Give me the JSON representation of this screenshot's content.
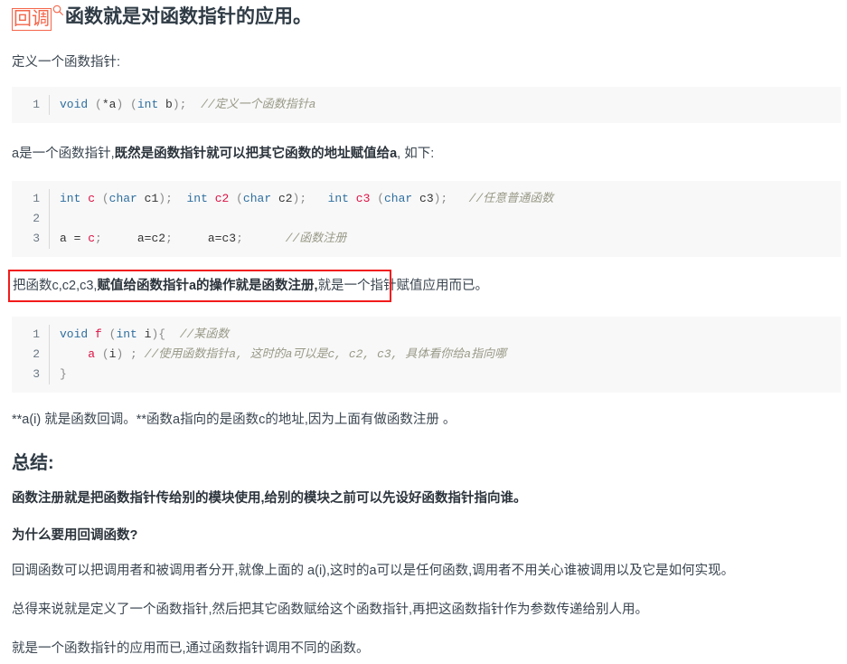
{
  "document": {
    "title_keyword": "回调",
    "title_icon": "search-icon",
    "title_rest": "函数就是对函数指针的应用。",
    "paragraphs": {
      "p_define": "定义一个函数指针:",
      "p_a_is_pointer_1": "a是一个函数指针,",
      "p_a_is_pointer_bold": "既然是函数指针就可以把其它函数的地址赋值给a",
      "p_a_is_pointer_2": ", 如下:",
      "p_register_1": "把函数c,c2,c3,",
      "p_register_bold": "赋值给函数指针a的操作就是函数注册,",
      "p_register_2": "就是一个指针赋值应用而已。",
      "p_callback": "**a(i) 就是函数回调。**函数a指向的是函数c的地址,因为上面有做函数注册 。",
      "p_summary_line": "函数注册就是把函数指针传给别的模块使用,给别的模块之前可以先设好函数指针指向谁。",
      "p_why_1": "回调函数可以把调用者和被调用者分开,就像上面的 a(i),这时的a可以是任何函数,调用者不用关心谁被调用以及它是如何实现。",
      "p_why_2": "总得来说就是定义了一个函数指针,然后把其它函数赋给这个函数指针,再把这函数指针作为参数传递给别人用。",
      "p_why_3": "就是一个函数指针的应用而已,通过函数指针调用不同的函数。"
    },
    "headings": {
      "summary": "总结:",
      "why_callback": "为什么要用回调函数?"
    },
    "code_blocks": [
      {
        "id": "code-block-1",
        "lines": [
          {
            "number": "1",
            "tokens": [
              {
                "text": "void",
                "cls": "t-kw"
              },
              {
                "text": " (",
                "cls": "t-punc"
              },
              {
                "text": "*a",
                "cls": "t-var"
              },
              {
                "text": ") (",
                "cls": "t-punc"
              },
              {
                "text": "int",
                "cls": "t-kw"
              },
              {
                "text": " b",
                "cls": "t-var"
              },
              {
                "text": ");  ",
                "cls": "t-punc"
              },
              {
                "text": "//定义一个函数指针a",
                "cls": "t-cmt"
              }
            ]
          }
        ]
      },
      {
        "id": "code-block-2",
        "lines": [
          {
            "number": "1",
            "tokens": [
              {
                "text": "int",
                "cls": "t-kw"
              },
              {
                "text": " ",
                "cls": "t-var"
              },
              {
                "text": "c",
                "cls": "t-fn"
              },
              {
                "text": " (",
                "cls": "t-punc"
              },
              {
                "text": "char",
                "cls": "t-kw"
              },
              {
                "text": " c1",
                "cls": "t-var"
              },
              {
                "text": ");  ",
                "cls": "t-punc"
              },
              {
                "text": "int",
                "cls": "t-kw"
              },
              {
                "text": " ",
                "cls": "t-var"
              },
              {
                "text": "c2",
                "cls": "t-fn"
              },
              {
                "text": " (",
                "cls": "t-punc"
              },
              {
                "text": "char",
                "cls": "t-kw"
              },
              {
                "text": " c2",
                "cls": "t-var"
              },
              {
                "text": ");   ",
                "cls": "t-punc"
              },
              {
                "text": "int",
                "cls": "t-kw"
              },
              {
                "text": " ",
                "cls": "t-var"
              },
              {
                "text": "c3",
                "cls": "t-fn"
              },
              {
                "text": " (",
                "cls": "t-punc"
              },
              {
                "text": "char",
                "cls": "t-kw"
              },
              {
                "text": " c3",
                "cls": "t-var"
              },
              {
                "text": ");   ",
                "cls": "t-punc"
              },
              {
                "text": "//任意普通函数",
                "cls": "t-cmt"
              }
            ]
          },
          {
            "number": "2",
            "tokens": []
          },
          {
            "number": "3",
            "tokens": [
              {
                "text": "a = ",
                "cls": "t-var"
              },
              {
                "text": "c",
                "cls": "t-fn"
              },
              {
                "text": ";     ",
                "cls": "t-punc"
              },
              {
                "text": "a=c2",
                "cls": "t-var"
              },
              {
                "text": ";     ",
                "cls": "t-punc"
              },
              {
                "text": "a=c3",
                "cls": "t-var"
              },
              {
                "text": ";      ",
                "cls": "t-punc"
              },
              {
                "text": "//函数注册",
                "cls": "t-cmt"
              }
            ]
          }
        ]
      },
      {
        "id": "code-block-3",
        "lines": [
          {
            "number": "1",
            "tokens": [
              {
                "text": "void",
                "cls": "t-kw"
              },
              {
                "text": " ",
                "cls": "t-var"
              },
              {
                "text": "f",
                "cls": "t-fn"
              },
              {
                "text": " (",
                "cls": "t-punc"
              },
              {
                "text": "int",
                "cls": "t-kw"
              },
              {
                "text": " i",
                "cls": "t-var"
              },
              {
                "text": "){  ",
                "cls": "t-punc"
              },
              {
                "text": "//某函数",
                "cls": "t-cmt"
              }
            ]
          },
          {
            "number": "2",
            "tokens": [
              {
                "text": "    ",
                "cls": "t-var"
              },
              {
                "text": "a",
                "cls": "t-fn"
              },
              {
                "text": " (",
                "cls": "t-punc"
              },
              {
                "text": "i",
                "cls": "t-var"
              },
              {
                "text": ") ; ",
                "cls": "t-punc"
              },
              {
                "text": "//使用函数指针a, 这时的a可以是c, c2, c3, 具体看你给a指向哪",
                "cls": "t-cmt"
              }
            ]
          },
          {
            "number": "3",
            "tokens": [
              {
                "text": "}",
                "cls": "t-punc"
              }
            ]
          }
        ]
      }
    ],
    "annotations": {
      "red_box_label": "red-annotation-box"
    },
    "colors": {
      "keyword_highlight": "#f4664a",
      "annotation_box": "#f21b1b",
      "code_background": "#f8f8f8",
      "code_keyword": "#2f6f9f",
      "code_function": "#d14",
      "code_comment": "#998877",
      "text": "#3b4650"
    }
  }
}
